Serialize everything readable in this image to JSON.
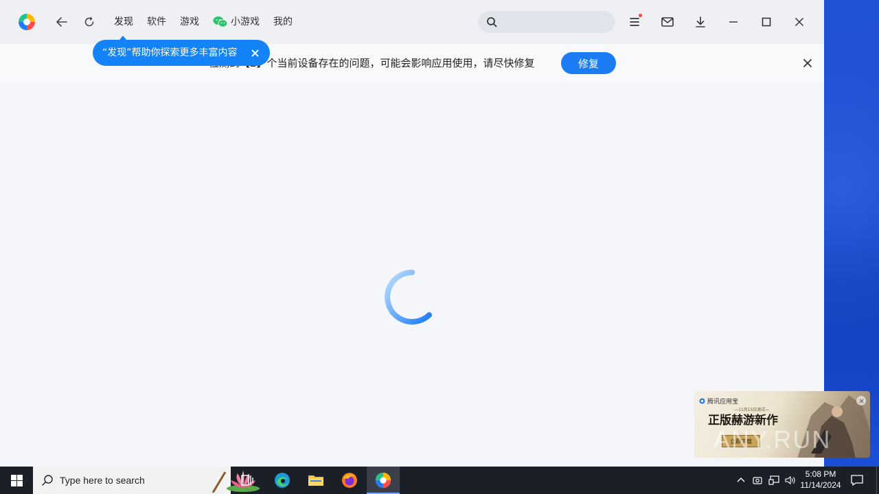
{
  "titlebar": {
    "tabs": [
      "发现",
      "软件",
      "游戏"
    ],
    "mini_game": "小游戏",
    "mine": "我的",
    "search_placeholder": ""
  },
  "notice": {
    "text": "检测到【2】个当前设备存在的问题，可能会影响应用使用，请尽快修复",
    "fix_label": "修复"
  },
  "bubble": {
    "text": "“发现”帮助你探索更多丰富内容"
  },
  "ad": {
    "brand": "腾讯应用宝",
    "subtitle": "—11月15日测试—",
    "title": "正版赫游新作",
    "button": "立即下载",
    "watermark": "ANY.RUN"
  },
  "taskbar": {
    "search_placeholder": "Type here to search",
    "time": "5:08 PM",
    "date": "11/14/2024"
  },
  "colors": {
    "accent": "#1b7cf4",
    "bubble": "#1483f7",
    "taskbar": "#1b1f27",
    "desktop": "#1546c7"
  }
}
